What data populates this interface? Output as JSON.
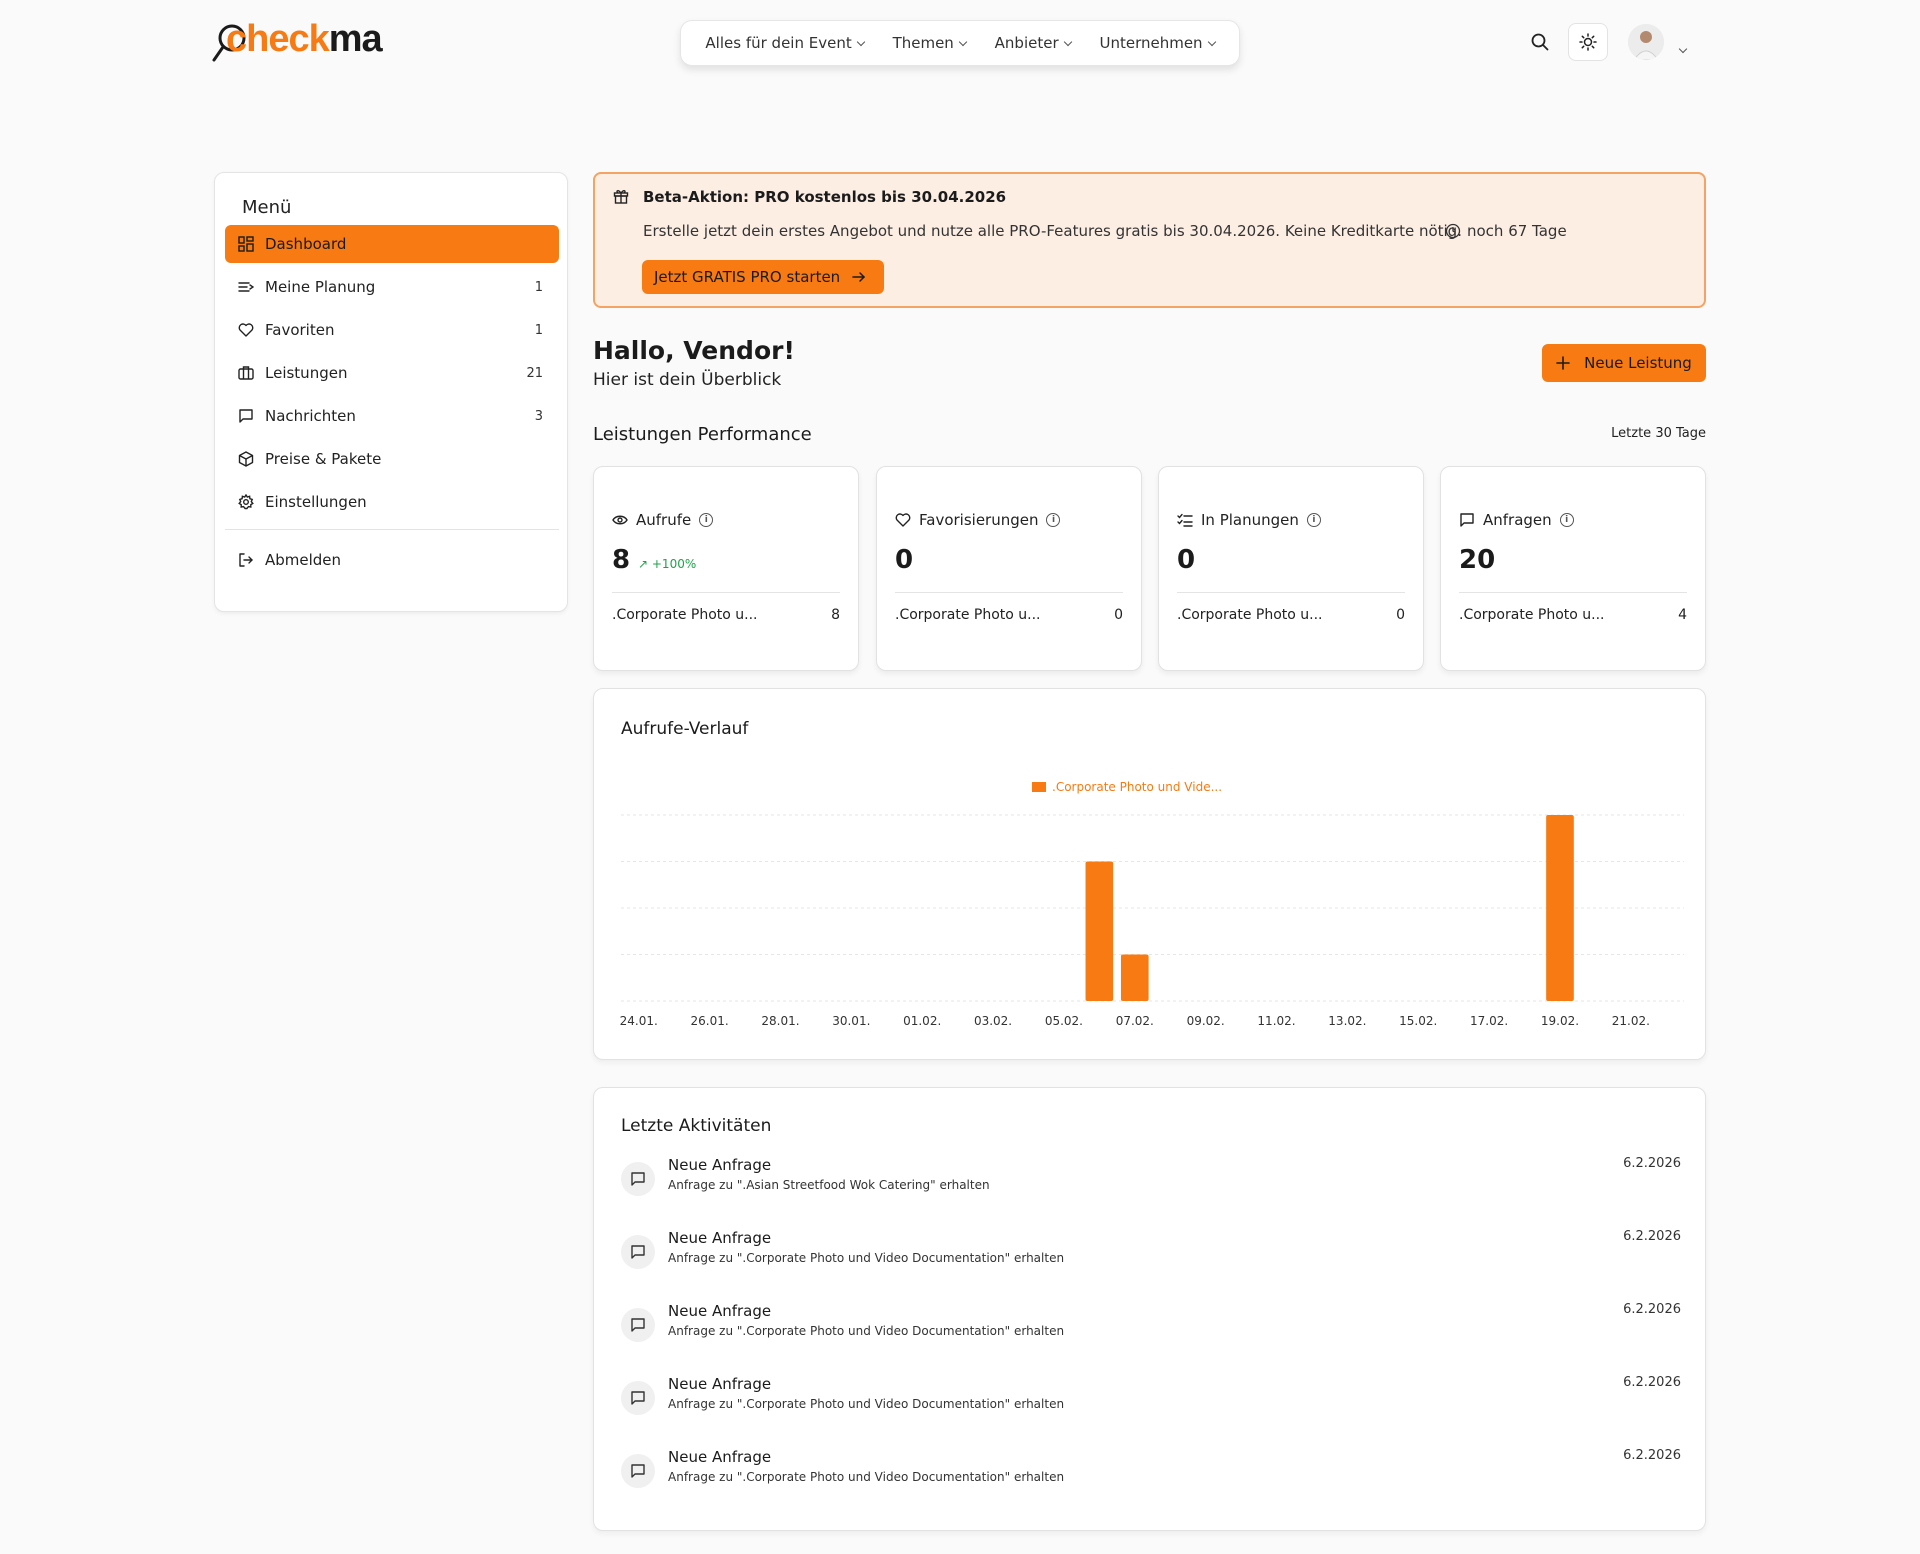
{
  "brand": {
    "logo_text_orange": "check",
    "logo_text_dark": "ma",
    "accent": "#f77a12"
  },
  "topnav": {
    "items": [
      "Alles für dein Event",
      "Themen",
      "Anbieter",
      "Unternehmen"
    ]
  },
  "header_icons": [
    "search-icon",
    "sun-icon",
    "avatar",
    "chevron-down-icon"
  ],
  "sidebar": {
    "title": "Menü",
    "items": [
      {
        "label": "Dashboard",
        "count": "",
        "icon": "dashboard-icon",
        "active": true
      },
      {
        "label": "Meine Planung",
        "count": "1",
        "icon": "list-icon"
      },
      {
        "label": "Favoriten",
        "count": "1",
        "icon": "heart-icon"
      },
      {
        "label": "Leistungen",
        "count": "21",
        "icon": "briefcase-icon"
      },
      {
        "label": "Nachrichten",
        "count": "3",
        "icon": "message-icon"
      },
      {
        "label": "Preise & Pakete",
        "count": "",
        "icon": "package-icon"
      },
      {
        "label": "Einstellungen",
        "count": "",
        "icon": "gear-icon"
      }
    ],
    "logout": "Abmelden"
  },
  "banner": {
    "title": "Beta-Aktion: PRO kostenlos bis 30.04.2026",
    "text": "Erstelle jetzt dein erstes Angebot und nutze alle PRO-Features gratis bis 30.04.2026. Keine Kreditkarte nötig.",
    "days": "noch 67 Tage",
    "cta": "Jetzt GRATIS PRO starten"
  },
  "greeting": {
    "title": "Hallo, Vendor!",
    "subtitle": "Hier ist dein Überblick"
  },
  "new_button": "Neue Leistung",
  "performance": {
    "title": "Leistungen Performance",
    "range": "Letzte 30 Tage",
    "cards": [
      {
        "label": "Aufrufe",
        "icon": "eye-icon",
        "value": "8",
        "trend": "+100%",
        "row_label": ".Corporate Photo u...",
        "row_value": "8"
      },
      {
        "label": "Favorisierungen",
        "icon": "heart-icon",
        "value": "0",
        "trend": "",
        "row_label": ".Corporate Photo u...",
        "row_value": "0"
      },
      {
        "label": "In Planungen",
        "icon": "checklist-icon",
        "value": "0",
        "trend": "",
        "row_label": ".Corporate Photo u...",
        "row_value": "0"
      },
      {
        "label": "Anfragen",
        "icon": "message-icon",
        "value": "20",
        "trend": "",
        "row_label": ".Corporate Photo u...",
        "row_value": "4"
      }
    ]
  },
  "chart_data": {
    "type": "bar",
    "title": "Aufrufe-Verlauf",
    "x_ticks": [
      "24.01.",
      "26.01.",
      "28.01.",
      "30.01.",
      "01.02.",
      "03.02.",
      "05.02.",
      "07.02.",
      "09.02.",
      "11.02.",
      "13.02.",
      "15.02.",
      "17.02.",
      "19.02.",
      "21.02."
    ],
    "categories": [
      "24.01.",
      "25.01.",
      "26.01.",
      "27.01.",
      "28.01.",
      "29.01.",
      "30.01.",
      "31.01.",
      "01.02.",
      "02.02.",
      "03.02.",
      "04.02.",
      "05.02.",
      "06.02.",
      "07.02.",
      "08.02.",
      "09.02.",
      "10.02.",
      "11.02.",
      "12.02.",
      "13.02.",
      "14.02.",
      "15.02.",
      "16.02.",
      "17.02.",
      "18.02.",
      "19.02.",
      "20.02.",
      "21.02.",
      "22.02."
    ],
    "series": [
      {
        "name": ".Corporate Photo und Vide...",
        "color": "#f77a12",
        "values": [
          0,
          0,
          0,
          0,
          0,
          0,
          0,
          0,
          0,
          0,
          0,
          0,
          0,
          3,
          1,
          0,
          0,
          0,
          0,
          0,
          0,
          0,
          0,
          0,
          0,
          0,
          4,
          0,
          0,
          0
        ]
      }
    ],
    "ylim": [
      0,
      4
    ],
    "grid": true,
    "legend": "top-center"
  },
  "activities": {
    "title": "Letzte Aktivitäten",
    "items": [
      {
        "name": "Neue Anfrage",
        "desc": "Anfrage zu \".Asian Streetfood Wok Catering\" erhalten",
        "date": "6.2.2026"
      },
      {
        "name": "Neue Anfrage",
        "desc": "Anfrage zu \".Corporate Photo und Video Documentation\" erhalten",
        "date": "6.2.2026"
      },
      {
        "name": "Neue Anfrage",
        "desc": "Anfrage zu \".Corporate Photo und Video Documentation\" erhalten",
        "date": "6.2.2026"
      },
      {
        "name": "Neue Anfrage",
        "desc": "Anfrage zu \".Corporate Photo und Video Documentation\" erhalten",
        "date": "6.2.2026"
      },
      {
        "name": "Neue Anfrage",
        "desc": "Anfrage zu \".Corporate Photo und Video Documentation\" erhalten",
        "date": "6.2.2026"
      }
    ]
  }
}
